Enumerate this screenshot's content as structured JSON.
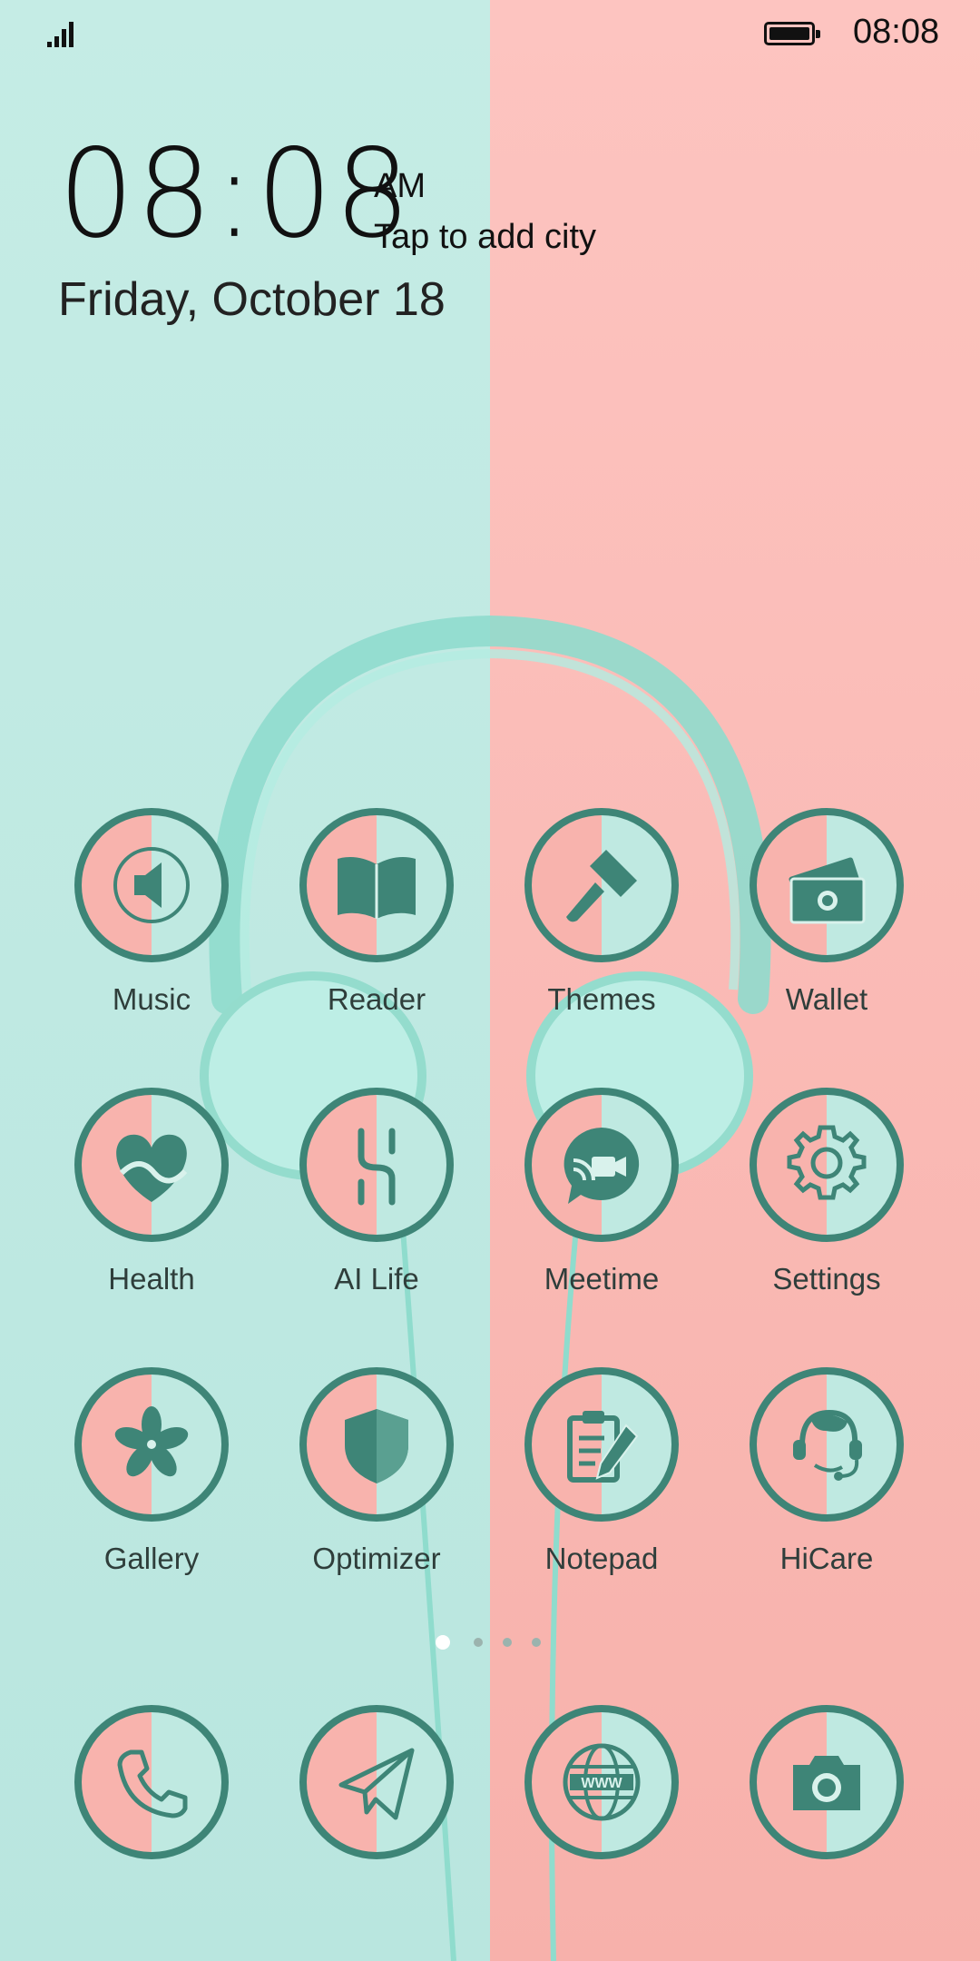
{
  "status_bar": {
    "time": "08:08",
    "signal_icon": "signal-bars-icon",
    "battery_icon": "battery-full-icon"
  },
  "lock_clock": {
    "time": "08:08",
    "ampm": "AM",
    "city_prompt": "Tap to add city",
    "date": "Friday, October 18"
  },
  "apps": [
    {
      "label": "Music",
      "icon": "speaker-icon"
    },
    {
      "label": "Reader",
      "icon": "book-icon"
    },
    {
      "label": "Themes",
      "icon": "paintbrush-icon"
    },
    {
      "label": "Wallet",
      "icon": "wallet-cash-icon"
    },
    {
      "label": "Health",
      "icon": "heart-icon"
    },
    {
      "label": "AI Life",
      "icon": "ai-life-icon"
    },
    {
      "label": "Meetime",
      "icon": "video-chat-icon"
    },
    {
      "label": "Settings",
      "icon": "gear-icon"
    },
    {
      "label": "Gallery",
      "icon": "flower-icon"
    },
    {
      "label": "Optimizer",
      "icon": "shield-icon"
    },
    {
      "label": "Notepad",
      "icon": "clipboard-pencil-icon"
    },
    {
      "label": "HiCare",
      "icon": "headset-agent-icon"
    }
  ],
  "dock": [
    {
      "icon": "phone-icon"
    },
    {
      "icon": "paper-plane-icon"
    },
    {
      "icon": "globe-www-icon"
    },
    {
      "icon": "camera-icon"
    }
  ],
  "page_indicator": {
    "count": 4,
    "active": 1
  },
  "colors": {
    "wall_left": "#c5ece5",
    "wall_right": "#fdc4c0",
    "icon_ring": "#3e8577",
    "icon_glyph": "#3e8577",
    "headphones": "#9fe3d6"
  }
}
